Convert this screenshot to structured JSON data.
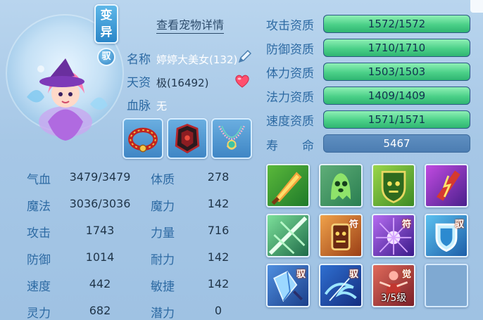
{
  "pet": {
    "variant_badge": [
      "变",
      "异"
    ],
    "tame_badge": "驭",
    "detail_link": "查看宠物详情",
    "name_label": "名称",
    "name_value": "婷婷大美女(132)",
    "aptitude_label": "天资",
    "aptitude_value": "极(16492)",
    "bloodline_label": "血脉",
    "bloodline_value": "无"
  },
  "equipment": [
    {
      "name": "collar"
    },
    {
      "name": "armor"
    },
    {
      "name": "necklace"
    }
  ],
  "stats": [
    {
      "label": "气血",
      "value": "3479/3479"
    },
    {
      "label": "魔法",
      "value": "3036/3036"
    },
    {
      "label": "攻击",
      "value": "1743"
    },
    {
      "label": "防御",
      "value": "1014"
    },
    {
      "label": "速度",
      "value": "442"
    },
    {
      "label": "灵力",
      "value": "682"
    }
  ],
  "attributes": [
    {
      "label": "体质",
      "value": "278"
    },
    {
      "label": "魔力",
      "value": "142"
    },
    {
      "label": "力量",
      "value": "716"
    },
    {
      "label": "耐力",
      "value": "142"
    },
    {
      "label": "敏捷",
      "value": "142"
    },
    {
      "label": "潜力",
      "value": "0"
    }
  ],
  "aptitudes": [
    {
      "label": "攻击资质",
      "value": "1572/1572",
      "fill": 1.0
    },
    {
      "label": "防御资质",
      "value": "1710/1710",
      "fill": 1.0
    },
    {
      "label": "体力资质",
      "value": "1503/1503",
      "fill": 1.0
    },
    {
      "label": "法力资质",
      "value": "1409/1409",
      "fill": 1.0
    },
    {
      "label": "速度资质",
      "value": "1571/1571",
      "fill": 1.0
    }
  ],
  "lifespan": {
    "label": "寿　　命",
    "value": "5467"
  },
  "skills": [
    {
      "icon": "sword-fire-skill-icon",
      "tag": "",
      "level": ""
    },
    {
      "icon": "ghost-skill-icon",
      "tag": "",
      "level": ""
    },
    {
      "icon": "shield-beast-skill-icon",
      "tag": "",
      "level": ""
    },
    {
      "icon": "lightning-skill-icon",
      "tag": "",
      "level": ""
    },
    {
      "icon": "slash-burst-skill-icon",
      "tag": "",
      "level": ""
    },
    {
      "icon": "totem-skill-icon",
      "tag": "符",
      "level": ""
    },
    {
      "icon": "purple-burst-skill-icon",
      "tag": "符",
      "level": ""
    },
    {
      "icon": "cyan-shield-skill-icon",
      "tag": "驭",
      "level": ""
    },
    {
      "icon": "crystal-skill-icon",
      "tag": "驭",
      "level": ""
    },
    {
      "icon": "blue-swirl-skill-icon",
      "tag": "驭",
      "level": ""
    },
    {
      "icon": "red-figure-skill-icon",
      "tag": "觉",
      "level": "3/5级"
    },
    {
      "icon": "empty-slot",
      "tag": "",
      "level": ""
    }
  ]
}
